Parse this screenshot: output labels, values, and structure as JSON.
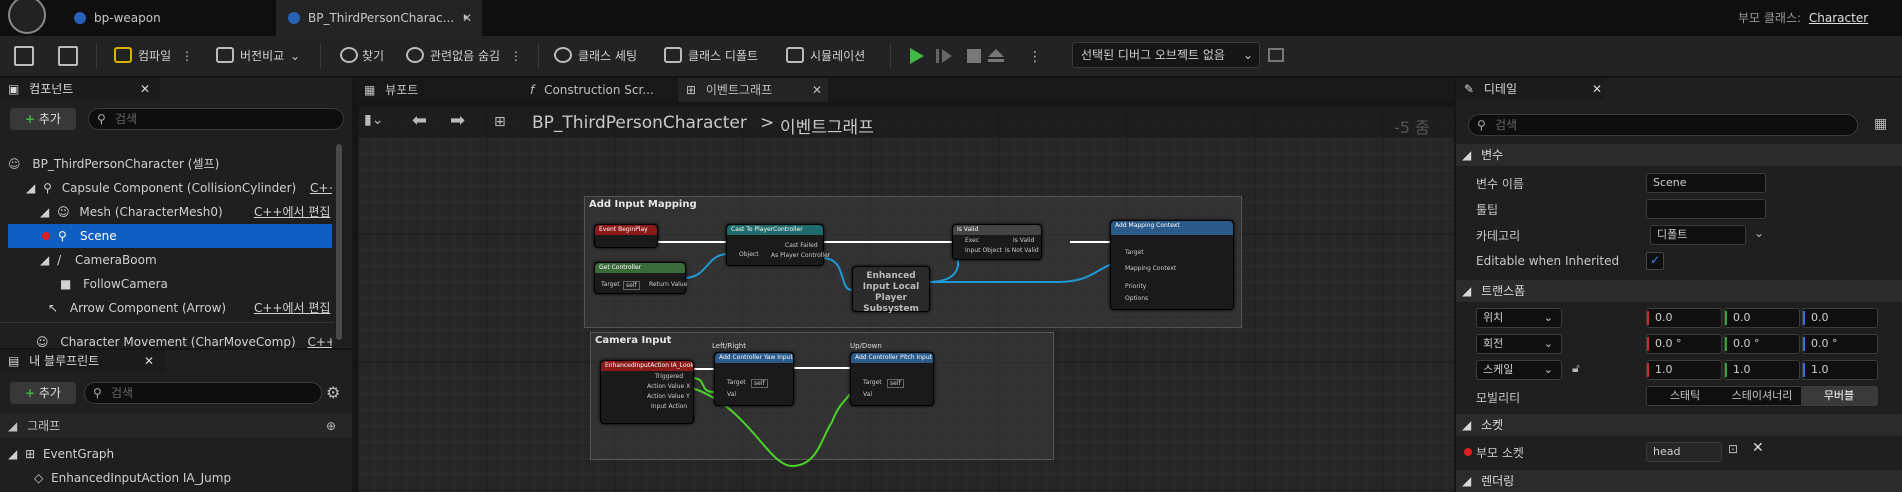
{
  "titlebar": {
    "tabs": [
      {
        "label": "bp-weapon"
      },
      {
        "label": "BP_ThirdPersonCharac...",
        "modified": "•"
      }
    ],
    "parent_class_label": "부모 클래스:",
    "parent_class_value": "Character"
  },
  "toolbar": {
    "compile": "컴파일",
    "diff": "버전비교",
    "find": "찾기",
    "hide_unrelated": "관련없음 숨김",
    "class_settings": "클래스 세팅",
    "class_defaults": "클래스 디폴트",
    "simulation": "시뮬레이션",
    "debug_object": "선택된 디버그 오브젝트 없음"
  },
  "components": {
    "title": "컴포넌트",
    "add_label": "추가",
    "search_placeholder": "검색",
    "items": [
      {
        "label": "BP_ThirdPersonCharacter (셀프)"
      },
      {
        "label": "Capsule Component (CollisionCylinder)",
        "edit": "C++에서"
      },
      {
        "label": "Mesh (CharacterMesh0)",
        "edit": "C++에서 편집"
      },
      {
        "label": "Scene"
      },
      {
        "label": "CameraBoom"
      },
      {
        "label": "FollowCamera"
      },
      {
        "label": "Arrow Component (Arrow)",
        "edit": "C++에서 편집"
      },
      {
        "label": "Character Movement (CharMoveComp)",
        "edit": "C++에서"
      }
    ]
  },
  "myblueprint": {
    "title": "내 블루프린트",
    "add_label": "추가",
    "search_placeholder": "검색",
    "graph_section": "그래프",
    "items": [
      {
        "label": "EventGraph"
      },
      {
        "label": "EnhancedInputAction IA_Jump"
      }
    ]
  },
  "editor_tabs": [
    {
      "label": "뷰포트"
    },
    {
      "label": "Construction Scr..."
    },
    {
      "label": "이벤트그래프"
    }
  ],
  "graph": {
    "breadcrumb_root": "BP_ThirdPersonCharacter",
    "breadcrumb_sep": ">",
    "breadcrumb_current": "이벤트그래프",
    "zoom": "-5 줌",
    "comments": [
      {
        "title": "Add Input Mapping"
      },
      {
        "title": "Camera Input"
      }
    ],
    "nodes": {
      "begin_play": "Event BeginPlay",
      "get_controller": "Get Controller",
      "cast": "Cast To PlayerController",
      "is_valid": "Is Valid",
      "add_mapping": "Add Mapping Context",
      "subsystem": "Enhanced Input Local Player Subsystem",
      "ia_look": "EnhancedInputAction IA_Look",
      "yaw": "Add Controller Yaw Input",
      "pitch": "Add Controller Pitch Input",
      "left_right": "Left/Right",
      "up_down": "Up/Down",
      "target_self": "self"
    },
    "pins": {
      "object": "Object",
      "cast_failed": "Cast Failed",
      "as_pc": "As Player Controller",
      "exec": "Exec",
      "is_valid": "Is Valid",
      "input_object": "Input Object",
      "is_not_valid": "Is Not Valid",
      "target": "Target",
      "mapping_context": "Mapping Context",
      "priority": "Priority",
      "options": "Options",
      "return_value": "Return Value",
      "triggered": "Triggered",
      "action_x": "Action Value X",
      "action_y": "Action Value Y",
      "input_action": "Input Action",
      "val": "Val"
    }
  },
  "details": {
    "title": "디테일",
    "search_placeholder": "검색",
    "sections": {
      "variable": "변수",
      "transform": "트랜스폼",
      "socket": "소켓",
      "rendering": "렌더링"
    },
    "variable_name_label": "변수 이름",
    "variable_name_value": "Scene",
    "tooltip_label": "툴팁",
    "tooltip_value": "",
    "category_label": "카테고리",
    "category_value": "디폴트",
    "editable_label": "Editable when Inherited",
    "editable_checked": true,
    "location_label": "위치",
    "location": [
      "0.0",
      "0.0",
      "0.0"
    ],
    "rotation_label": "회전",
    "rotation": [
      "0.0 °",
      "0.0 °",
      "0.0 °"
    ],
    "scale_label": "스케일",
    "scale": [
      "1.0",
      "1.0",
      "1.0"
    ],
    "mobility_label": "모빌리티",
    "mobility_options": [
      "스태틱",
      "스테이셔너리",
      "무버블"
    ],
    "mobility_selected": "무버블",
    "parent_socket_label": "부모 소켓",
    "parent_socket_value": "head"
  },
  "colors": {
    "selection": "#0f5fc2",
    "event_node": "#8a1a1a",
    "function_node": "#2a5a8a",
    "exec_wire": "#ffffff",
    "object_wire": "#1e9ad6",
    "float_wire": "#4bd12a",
    "play_green": "#3fb93f"
  }
}
